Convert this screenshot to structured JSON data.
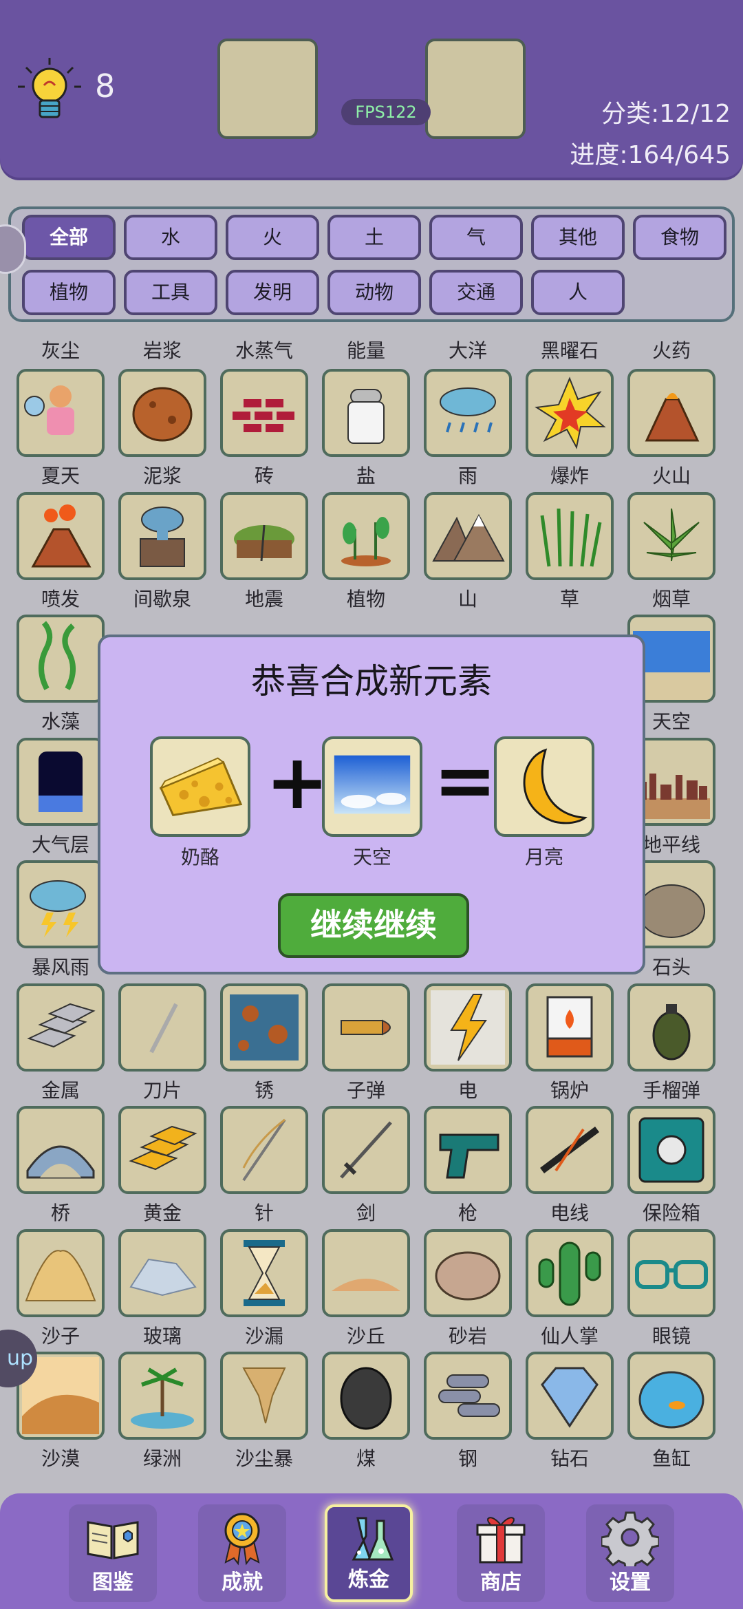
{
  "header": {
    "hint_count": "8",
    "fps": "FPS122",
    "category": "分类:12/12",
    "progress": "进度:164/645"
  },
  "filters": [
    "全部",
    "水",
    "火",
    "土",
    "气",
    "其他",
    "食物",
    "植物",
    "工具",
    "发明",
    "动物",
    "交通",
    "人"
  ],
  "partial_row_labels": [
    "灰尘",
    "岩浆",
    "水蒸气",
    "能量",
    "大洋",
    "黑曜石",
    "火药"
  ],
  "grid": [
    [
      "夏天",
      "泥浆",
      "砖",
      "盐",
      "雨",
      "爆炸",
      "火山"
    ],
    [
      "喷发",
      "间歇泉",
      "地震",
      "植物",
      "山",
      "草",
      "烟草"
    ],
    [
      "水藻",
      "",
      "",
      "",
      "",
      "",
      "天空"
    ],
    [
      "大气层",
      "",
      "",
      "",
      "",
      "",
      "地平线"
    ],
    [
      "暴风雨",
      "",
      "",
      "",
      "",
      "",
      "石头"
    ],
    [
      "金属",
      "刀片",
      "锈",
      "子弹",
      "电",
      "锅炉",
      "手榴弹"
    ],
    [
      "桥",
      "黄金",
      "针",
      "剑",
      "枪",
      "电线",
      "保险箱"
    ],
    [
      "沙子",
      "玻璃",
      "沙漏",
      "沙丘",
      "砂岩",
      "仙人掌",
      "眼镜"
    ],
    [
      "沙漠",
      "绿洲",
      "沙尘暴",
      "煤",
      "钢",
      "钻石",
      "鱼缸"
    ]
  ],
  "dialog": {
    "title": "恭喜合成新元素",
    "ingredient_a": "奶酪",
    "ingredient_b": "天空",
    "result": "月亮",
    "plus": "+",
    "equals": "=",
    "button": "继续继续"
  },
  "side_tab": "up",
  "nav": [
    {
      "label": "图鉴",
      "icon": "book-icon"
    },
    {
      "label": "成就",
      "icon": "medal-icon"
    },
    {
      "label": "炼金",
      "icon": "flask-icon"
    },
    {
      "label": "商店",
      "icon": "gift-icon"
    },
    {
      "label": "设置",
      "icon": "gear-icon"
    }
  ],
  "nav_active": "炼金"
}
